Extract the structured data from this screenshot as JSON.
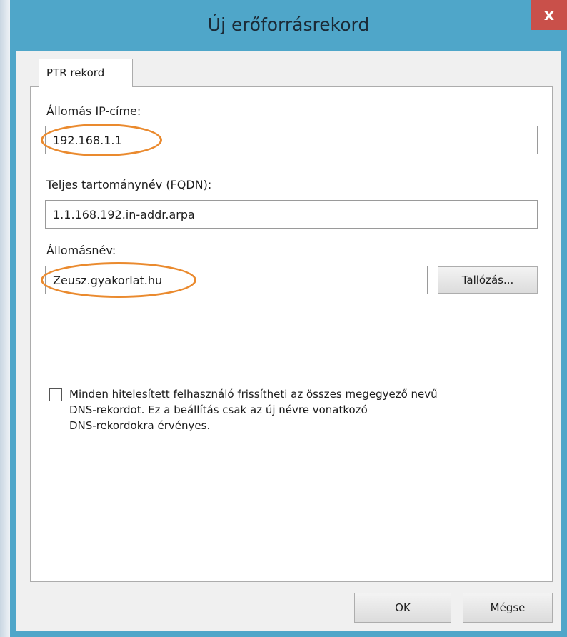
{
  "window": {
    "title": "Új erőforrásrekord",
    "close_label": "x"
  },
  "tabs": [
    {
      "label": "PTR rekord",
      "active": true
    }
  ],
  "form": {
    "ip_label": "Állomás IP-címe:",
    "ip_value": "192.168.1.1",
    "fqdn_label": "Teljes tartománynév (FQDN):",
    "fqdn_value": "1.1.168.192.in-addr.arpa",
    "host_label": "Állomásnév:",
    "host_value": "Zeusz.gyakorlat.hu",
    "browse_label": "Tallózás...",
    "checkbox_checked": false,
    "checkbox_lines": [
      "Minden hitelesített felhasználó frissítheti az összes megegyező nevű",
      "DNS-rekordot. Ez a beállítás csak az új névre vonatkozó",
      "DNS-rekordokra érvényes."
    ]
  },
  "footer": {
    "ok_label": "OK",
    "cancel_label": "Mégse"
  },
  "colors": {
    "window_frame": "#4fa6c9",
    "close_button": "#c9504a",
    "highlight": "#ea8a2e"
  }
}
